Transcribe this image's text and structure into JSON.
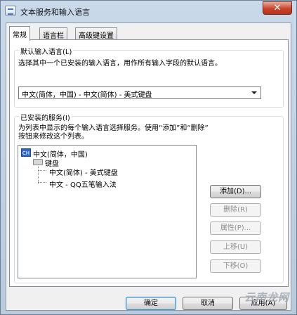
{
  "window": {
    "title": "文本服务和输入语言",
    "close_glyph": "✕"
  },
  "tabs": [
    {
      "label": "常规",
      "active": true
    },
    {
      "label": "语言栏",
      "active": false
    },
    {
      "label": "高级键设置",
      "active": false
    }
  ],
  "default_language": {
    "legend": "默认输入语言(L)",
    "description": "选择其中一个已安装的输入语言，用作所有输入字段的默认语言。",
    "selected": "中文(简体，中国) - 中文(简体) - 美式键盘"
  },
  "installed_services": {
    "legend": "已安装的服务(I)",
    "description_line1": "为列表中显示的每个输入语言选择服务。使用“添加”和“删除”",
    "description_line2": "按钮来修改这个列表。",
    "tree": {
      "language_icon_text": "CH",
      "language": "中文(简体，中国)",
      "group": "键盘",
      "items": [
        "中文(简体) - 美式键盘",
        "中文 - QQ五笔输入法"
      ]
    },
    "buttons": {
      "add": "添加(D)...",
      "remove": "删除(R)",
      "properties": "属性(P)...",
      "move_up": "上移(U)",
      "move_down": "下移(O)"
    }
  },
  "footer": {
    "ok": "确定",
    "cancel": "取消",
    "apply": "应用(A)"
  },
  "watermark": "云南龙网"
}
